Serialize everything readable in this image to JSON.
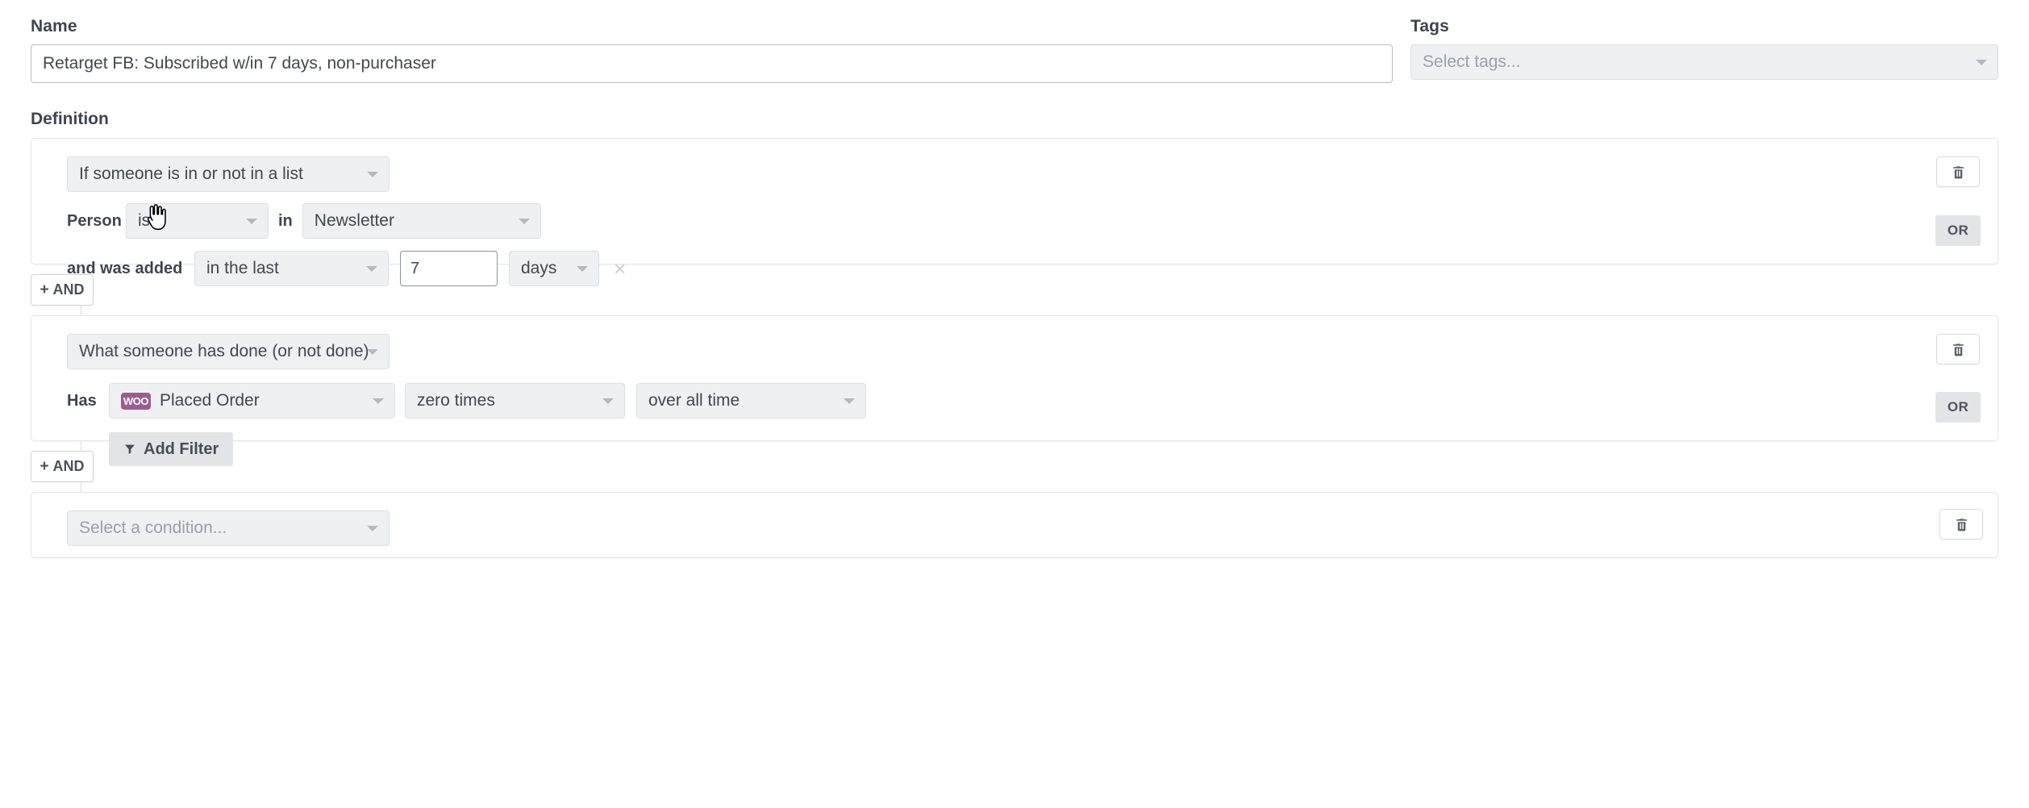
{
  "form": {
    "name_label": "Name",
    "name_value": "Retarget FB: Subscribed w/in 7 days, non-purchaser",
    "name_placeholder": "Name",
    "tags_label": "Tags",
    "tags_placeholder": "Select tags...",
    "definition_label": "Definition"
  },
  "blocks": [
    {
      "condition_type": "If someone is in or not in a list",
      "delete_label": "trash-icon",
      "or_label": "OR",
      "row1": {
        "prefix_label": "Person",
        "operator": "is",
        "join_label": "in",
        "list_name": "Newsletter"
      },
      "row2": {
        "prefix_label": "and was added",
        "timeframe": "in the last",
        "amount": "7",
        "unit": "days",
        "remove_label": "×"
      }
    },
    {
      "condition_type": "What someone has done (or not done)",
      "delete_label": "trash-icon",
      "or_label": "OR",
      "row1": {
        "prefix_label": "Has",
        "metric_badge": "WOO",
        "metric": "Placed Order",
        "frequency": "zero times",
        "window": "over all time"
      },
      "add_filter_label": "Add Filter"
    },
    {
      "condition_type": "Select a condition...",
      "delete_label": "trash-icon"
    }
  ],
  "and_buttons": [
    {
      "label": "AND",
      "plus": "+"
    },
    {
      "label": "AND",
      "plus": "+"
    }
  ],
  "colors": {
    "accent_woo": "#9b5c8f",
    "control_bg": "#eff0f2",
    "button_bg": "#e3e4e6",
    "text": "#3f4450",
    "placeholder": "#9ba0aa"
  }
}
